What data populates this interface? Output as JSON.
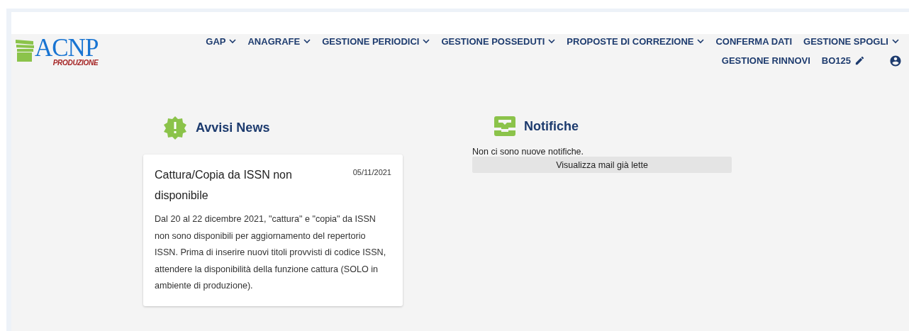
{
  "logo": {
    "title": "ACNP",
    "subtitle": "PRODUZIONE"
  },
  "nav": [
    {
      "label": "GAP",
      "dropdown": true
    },
    {
      "label": "ANAGRAFE",
      "dropdown": true
    },
    {
      "label": "GESTIONE PERIODICI",
      "dropdown": true
    },
    {
      "label": "GESTIONE POSSEDUTI",
      "dropdown": true
    },
    {
      "label": "PROPOSTE DI CORREZIONE",
      "dropdown": true
    },
    {
      "label": "CONFERMA DATI",
      "dropdown": false
    },
    {
      "label": "GESTIONE SPOGLI",
      "dropdown": true
    },
    {
      "label": "GESTIONE RINNOVI",
      "dropdown": false
    }
  ],
  "user": {
    "code": "BO125"
  },
  "news": {
    "title": "Avvisi News",
    "items": [
      {
        "title": "Cattura/Copia da ISSN non disponibile",
        "date": "05/11/2021",
        "body": "Dal 20 al 22 dicembre 2021, \"cattura\" e \"copia\" da ISSN non sono disponibili per aggiornamento del repertorio ISSN. Prima di inserire nuovi titoli provvisti di codice ISSN, attendere la disponibilità della funzione cattura (SOLO in ambiente di produzione)."
      }
    ]
  },
  "notifications": {
    "title": "Notifiche",
    "empty_text": "Non ci sono nuove notifiche.",
    "button": "Visualizza mail già lette"
  }
}
